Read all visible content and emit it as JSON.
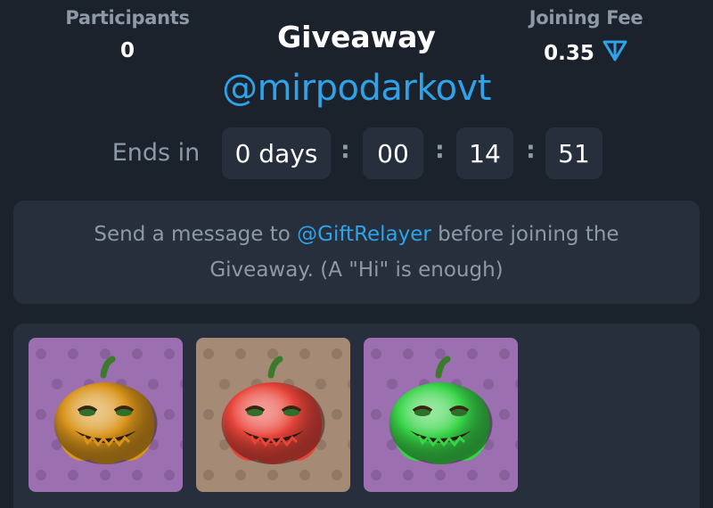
{
  "participants": {
    "label": "Participants",
    "value": "0"
  },
  "fee": {
    "label": "Joining Fee",
    "value": "0.35",
    "currency_icon": "ton-icon"
  },
  "title": "Giveaway",
  "channel": "@mirpodarkovt",
  "timer": {
    "label": "Ends in",
    "days": "0 days",
    "hours": "00",
    "minutes": "14",
    "seconds": "51",
    "separator": ":"
  },
  "notice": {
    "prefix": "Send a message to ",
    "mention": "@GiftRelayer",
    "suffix": " before joining the",
    "line2": "Giveaway. (A \"Hi\" is enough)"
  },
  "gifts": [
    {
      "name": "pumpkin-gift",
      "background": "#9b6fb0",
      "body": "#d9951c"
    },
    {
      "name": "pumpkin-gift",
      "background": "#a58a76",
      "body": "#e8453a"
    },
    {
      "name": "pumpkin-gift",
      "background": "#9b6fb0",
      "body": "#38d448"
    }
  ],
  "colors": {
    "accent": "#2ea3ea",
    "background": "#1b222c",
    "card": "#262f3b",
    "muted": "#8e99a8"
  }
}
